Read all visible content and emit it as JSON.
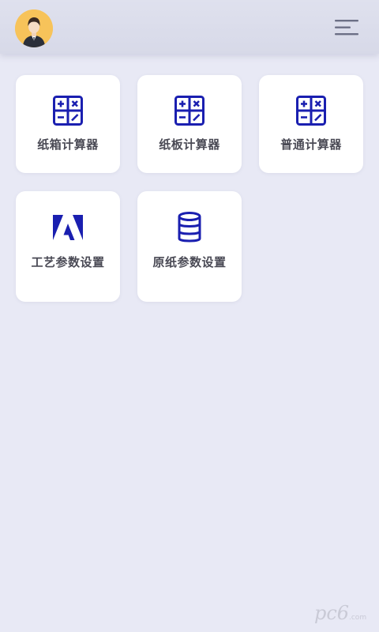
{
  "header": {
    "avatar": "avatar",
    "menu_icon": "hamburger-menu-icon"
  },
  "cards": [
    {
      "label": "纸箱计算器",
      "icon": "calculator-icon"
    },
    {
      "label": "纸板计算器",
      "icon": "calculator-icon"
    },
    {
      "label": "普通计算器",
      "icon": "calculator-icon"
    },
    {
      "label": "工艺参数设置",
      "icon": "adobe-icon"
    },
    {
      "label": "原纸参数设置",
      "icon": "database-icon"
    }
  ],
  "watermark": {
    "text": "pc6",
    "subtext": ".com"
  },
  "colors": {
    "background": "#e8e9f5",
    "icon": "#1a1fb0",
    "label": "#4a4a55"
  }
}
